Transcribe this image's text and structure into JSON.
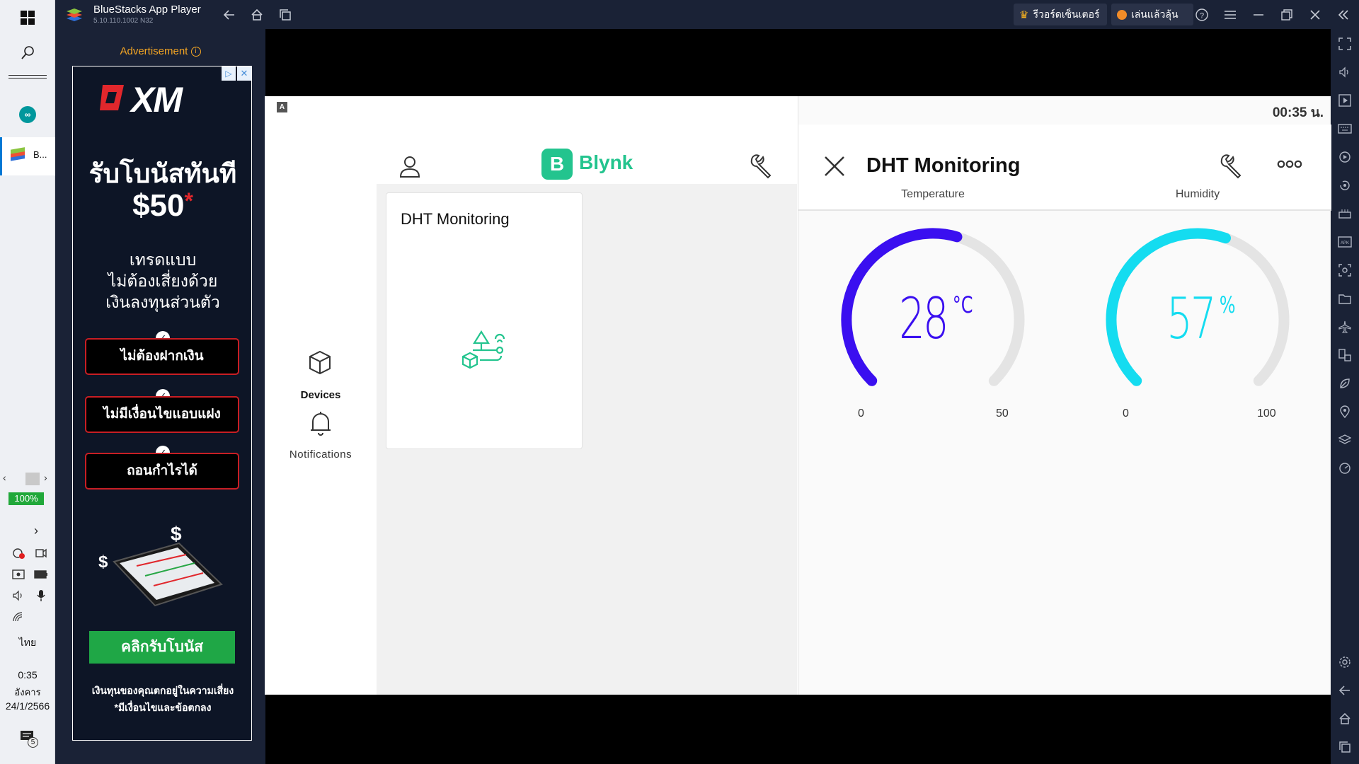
{
  "taskbar": {
    "zoom": "100%",
    "language": "ไทย",
    "clock_time": "0:35",
    "clock_day": "อังคาร",
    "clock_date": "24/1/2566",
    "notif_count": "5",
    "app_label": "B..."
  },
  "window": {
    "title": "BlueStacks App Player",
    "version": "5.10.110.1002  N32",
    "pill_review": "รีวอร์ดเซ็นเตอร์",
    "pill_play": "เล่นแล้วลุ้น"
  },
  "ad": {
    "label": "Advertisement",
    "brand": "XM",
    "headline": "รับโบนัสทันที",
    "amount": "$50",
    "amount_star": "*",
    "sub1": "เทรดแบบ",
    "sub2": "ไม่ต้องเสี่ยงด้วย",
    "sub3": "เงินลงทุนส่วนตัว",
    "bullets": [
      "ไม่ต้องฝากเงิน",
      "ไม่มีเงื่อนไขแอบแฝง",
      "ถอนกำไรได้"
    ],
    "cta": "คลิกรับโบนัส",
    "disclaimer1": "เงินทุนของคุณตกอยู่ในความเสี่ยง",
    "disclaimer2": "*มีเงื่อนไขและข้อตกลง"
  },
  "android": {
    "status_time": "00:35 น.",
    "status_badge": "A"
  },
  "blynk": {
    "logo_letter": "B",
    "logo_text": "Blynk",
    "nav": [
      {
        "label": "Devices"
      },
      {
        "label": "Notifications"
      }
    ],
    "device_card_title": "DHT Monitoring",
    "detail_title": "DHT Monitoring",
    "gauges": [
      {
        "label": "Temperature",
        "value": "28",
        "unit": "°C",
        "min": "0",
        "max": "50",
        "num": 28,
        "lo": 0,
        "hi": 50,
        "color": "#3a0ff0"
      },
      {
        "label": "Humidity",
        "value": "57",
        "unit": "%",
        "min": "0",
        "max": "100",
        "num": 57,
        "lo": 0,
        "hi": 100,
        "color": "#14dcf0"
      }
    ],
    "brand_color": "#23c48e"
  }
}
